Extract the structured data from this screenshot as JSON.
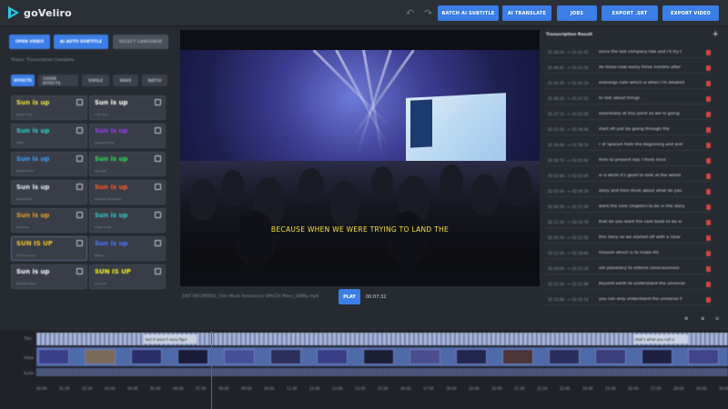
{
  "app": {
    "name": "goVeliro"
  },
  "toolbar": {
    "undo_icon": "undo-icon",
    "redo_icon": "redo-icon",
    "buttons": [
      {
        "label": "BATCH AI SUBTITLE"
      },
      {
        "label": "AI TRANSLATE"
      },
      {
        "label": "JOBS"
      },
      {
        "label": "EXPORT .SRT"
      },
      {
        "label": "EXPORT VIDEO"
      }
    ]
  },
  "left": {
    "buttons": [
      {
        "label": "OPEN VIDEO"
      },
      {
        "label": "AI AUTO SUBTITLE"
      },
      {
        "label": "SELECT LANGUAGE"
      }
    ],
    "status": "Status: Transcription Complete",
    "tabs": [
      {
        "label": "EFFECTS"
      },
      {
        "label": "COVER EFFECTS"
      },
      {
        "label": "SINGLE"
      },
      {
        "label": "WAVE"
      },
      {
        "label": "BATCH"
      }
    ],
    "effects": [
      {
        "text": "Sun is up",
        "name": "Electric Pop",
        "color": "#f2e23a"
      },
      {
        "text": "Sun is up",
        "name": "Color Pop",
        "color": "#ffffff"
      },
      {
        "text": "Sun is up",
        "name": "Glitch",
        "color": "#2fd3c8"
      },
      {
        "text": "Sun is up",
        "name": "Gradient Glow",
        "color": "#9c3cf0"
      },
      {
        "text": "Sun is up",
        "name": "Neonbolt Hit",
        "color": "#3aa0ff"
      },
      {
        "text": "Sun is up",
        "name": "Neonyte",
        "color": "#2ee05c"
      },
      {
        "text": "Sun is up",
        "name": "Natural Pop",
        "color": "#e8ecf2"
      },
      {
        "text": "Sun is up",
        "name": "Rainbow Typewriter",
        "color": "#ff5a2a"
      },
      {
        "text": "Sun is up",
        "name": "Fire Glow",
        "color": "#e8a020"
      },
      {
        "text": "Sun is up",
        "name": "Cheer Ft Rip",
        "color": "#36c7c7"
      },
      {
        "text": "SUN IS UP",
        "name": "The Sun Goes",
        "color": "#f2c222"
      },
      {
        "text": "Sun is up",
        "name": "Wavey",
        "color": "#4a78ff"
      },
      {
        "text": "Sun is up",
        "name": "Butterfly Blast",
        "color": "#ffffff"
      },
      {
        "text": "SUN IS UP",
        "name": "Sunny Pi",
        "color": "#f7f022"
      }
    ]
  },
  "video": {
    "subtitle": "BECAUSE WHEN WE WERE TRYING TO LAND THE",
    "filename": "JUST RECORDED_ Elon Musk Announces SPACEX Plans_1080p.mp4",
    "play_label": "PLAY",
    "time": "00:07:32"
  },
  "transcription": {
    "title": "Transcription Result",
    "add_icon": "plus-icon",
    "delete_icon": "trash-icon",
    "rows": [
      {
        "time": "01:26:24 --> 01:42:42",
        "text": "since the last company talk and I'll try t"
      },
      {
        "time": "01:40:42 --> 01:43:30",
        "text": "do these now every three months after"
      },
      {
        "time": "01:43:30 --> 01:45:24",
        "text": "evenings calls which is when I'm allowed"
      },
      {
        "time": "01:46:24 --> 01:47:12",
        "text": "to talk about things"
      },
      {
        "time": "01:47:12 --> 01:52:56",
        "text": "essentially at this point so we're going"
      },
      {
        "time": "01:52:56 --> 01:56:46",
        "text": "start off just by going through the"
      },
      {
        "time": "01:56:46 --> 01:58:74",
        "text": "r of SpaceX from the beginning and and"
      },
      {
        "time": "01:58:74 --> 02:01:64",
        "text": "then to present day I think once"
      },
      {
        "time": "02:01:64 --> 02:03:04",
        "text": "in a while it's good to look at the whole"
      },
      {
        "time": "02:03:04 --> 02:06:50",
        "text": "story and then think about what do you"
      },
      {
        "time": "02:06:50 --> 02:11:34",
        "text": "want the next chapters to be in the story"
      },
      {
        "time": "02:11:34 --> 02:10:70",
        "text": "that do you want the next book to be in"
      },
      {
        "time": "02:10:70 --> 02:12:56",
        "text": "this story so we started off with a clear"
      },
      {
        "time": "02:12:56 --> 02:18:64",
        "text": "mission which is to make life"
      },
      {
        "time": "02:18:64 --> 02:23:18",
        "text": "ulti planetary to extend consciousness"
      },
      {
        "time": "02:23:18 --> 02:25:88",
        "text": "beyond earth to understand the universe"
      },
      {
        "time": "02:25:88 --> 02:30:14",
        "text": "you can only understand the universe if"
      }
    ]
  },
  "timeline": {
    "labels": {
      "title": "Title",
      "video": "Video",
      "audio": "Audio"
    },
    "clips": [
      {
        "text": "but it wasn't easy figur"
      },
      {
        "text": "that's what you call a"
      }
    ],
    "ruler": [
      "00:00",
      "01:00",
      "02:00",
      "03:00",
      "04:00",
      "05:00",
      "06:00",
      "07:00",
      "08:00",
      "09:00",
      "10:00",
      "11:00",
      "12:00",
      "13:00",
      "14:00",
      "15:00",
      "16:00",
      "17:00",
      "18:00",
      "19:00",
      "20:00",
      "21:00",
      "22:00",
      "23:00",
      "24:00",
      "25:00",
      "26:00",
      "27:00",
      "28:00",
      "29:00",
      "30:00"
    ],
    "zoom_in_icon": "zoom-in-icon",
    "zoom_out_icon": "zoom-out-icon",
    "settings_icon": "settings-icon"
  },
  "colors": {
    "accent": "#3a7ee6",
    "background": "#262a31",
    "subtitle": "#f7e23a",
    "delete": "#d94444",
    "playhead": "#e03030"
  }
}
